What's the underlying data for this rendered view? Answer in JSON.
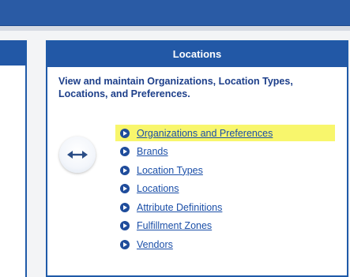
{
  "locations_panel": {
    "title": "Locations",
    "description": "View and maintain Organizations, Location Types, Locations, and Preferences.",
    "icon": "double-arrow-icon",
    "links": [
      {
        "label": "Organizations and Preferences",
        "highlighted": true
      },
      {
        "label": "Brands"
      },
      {
        "label": "Location Types"
      },
      {
        "label": "Locations"
      },
      {
        "label": "Attribute Definitions"
      },
      {
        "label": "Fulfillment Zones"
      },
      {
        "label": "Vendors"
      }
    ]
  },
  "colors": {
    "header_blue": "#2258a6",
    "link_blue": "#1b4fa8",
    "highlight_yellow": "#f8f66c"
  }
}
